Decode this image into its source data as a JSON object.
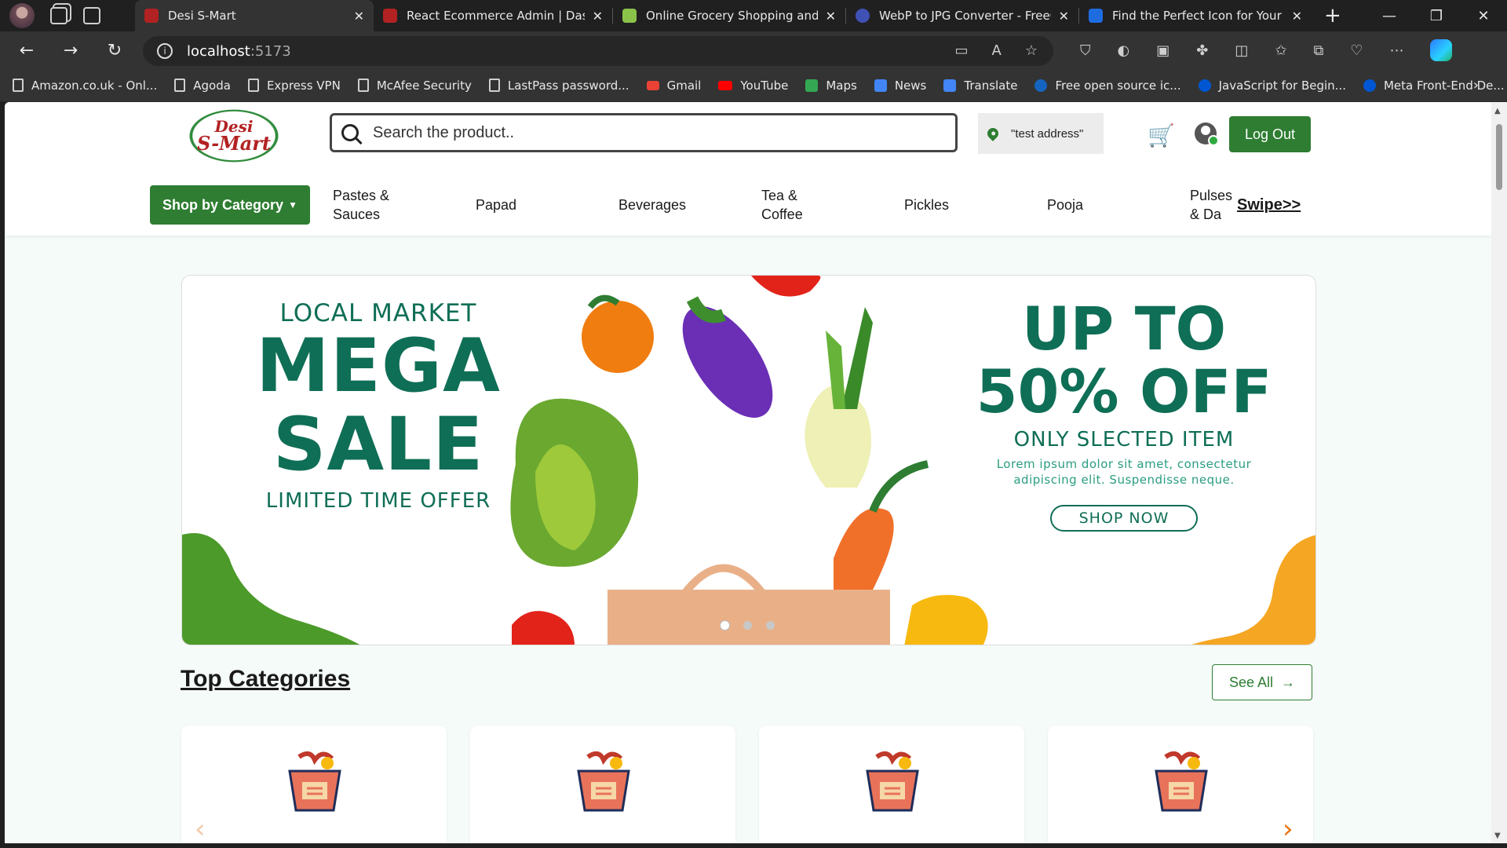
{
  "browser": {
    "tabs": [
      {
        "title": "Desi S-Mart",
        "active": true,
        "favicon_color": "#b22222"
      },
      {
        "title": "React Ecommerce Admin | Dashb",
        "active": false,
        "favicon_color": "#b22222"
      },
      {
        "title": "Online Grocery Shopping and Or",
        "active": false,
        "favicon_color": "#8bc34a"
      },
      {
        "title": "WebP to JPG Converter - FreeCo",
        "active": false,
        "favicon_color": "#3f51b5"
      },
      {
        "title": "Find the Perfect Icon for Your Pr",
        "active": false,
        "favicon_color": "#1e6ce0"
      }
    ],
    "url_host": "localhost",
    "url_port": ":5173",
    "bookmarks": [
      {
        "label": "Amazon.co.uk - Onl...",
        "icon": "page-icon"
      },
      {
        "label": "Agoda",
        "icon": "page-icon"
      },
      {
        "label": "Express VPN",
        "icon": "page-icon"
      },
      {
        "label": "McAfee Security",
        "icon": "page-icon"
      },
      {
        "label": "LastPass password...",
        "icon": "page-icon"
      },
      {
        "label": "Gmail",
        "icon": "gmail-icon",
        "color": "#ea4335"
      },
      {
        "label": "YouTube",
        "icon": "youtube-icon",
        "color": "#ff0000"
      },
      {
        "label": "Maps",
        "icon": "maps-icon",
        "color": "#34a853"
      },
      {
        "label": "News",
        "icon": "news-icon",
        "color": "#4285f4"
      },
      {
        "label": "Translate",
        "icon": "translate-icon",
        "color": "#4285f4"
      },
      {
        "label": "Free open source ic...",
        "icon": "globe-icon",
        "color": "#1565c0"
      },
      {
        "label": "JavaScript for Begin...",
        "icon": "coursera-icon",
        "color": "#0056d2"
      },
      {
        "label": "Meta Front-End De...",
        "icon": "coursera-icon",
        "color": "#0056d2"
      }
    ]
  },
  "site": {
    "logo_line1": "Desi",
    "logo_line2": "S-Mart",
    "search_placeholder": "Search the product..",
    "address": "\"test address\"",
    "logout_label": "Log Out",
    "shop_by_category_label": "Shop by Category",
    "categories": [
      "Pastes & Sauces",
      "Papad",
      "Beverages",
      "Tea & Coffee",
      "Pickles",
      "Pooja",
      "Pulses & Da"
    ],
    "swipe_label": "Swipe>>",
    "colors": {
      "brand_green": "#2e7d32",
      "banner_teal": "#0f6e56",
      "accent_orange": "#e8730f",
      "logo_red": "#b22222"
    }
  },
  "banner": {
    "local_market": "LOCAL MARKET",
    "mega": "MEGA",
    "sale": "SALE",
    "limited": "LIMITED TIME OFFER",
    "up_to": "UP TO",
    "percent_off": "50% OFF",
    "only_selected": "ONLY SLECTED ITEM",
    "lorem": "Lorem ipsum dolor sit amet, consectetur adipiscing elit. Suspendisse neque.",
    "shop_now": "SHOP NOW",
    "slides": 3,
    "active_slide": 1
  },
  "top_categories": {
    "title": "Top Categories",
    "see_all": "See All",
    "card_count": 4
  }
}
